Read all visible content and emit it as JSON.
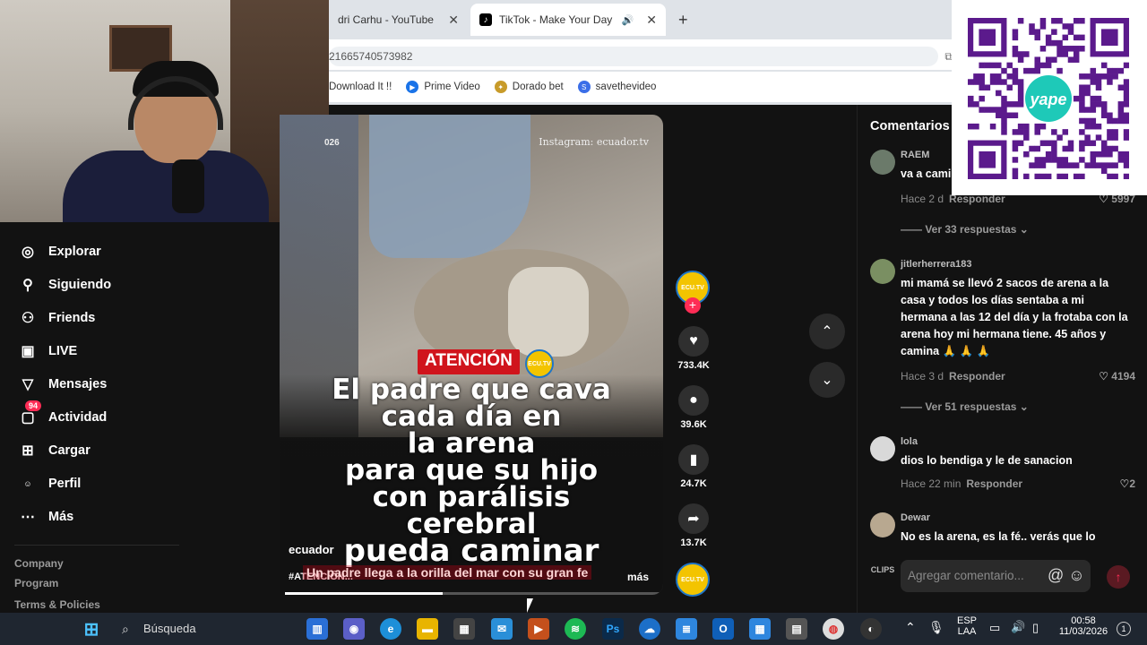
{
  "browser": {
    "tabs": [
      {
        "label": "dri Carhu - YouTube"
      },
      {
        "label": "TikTok - Make Your Day"
      }
    ],
    "new_tab": "+",
    "address": "21665740573982",
    "bookmarks": [
      {
        "label": "Download It !!"
      },
      {
        "label": "Prime Video"
      },
      {
        "label": "Dorado bet"
      },
      {
        "label": "savethevideo"
      }
    ]
  },
  "sidebar": {
    "items": [
      {
        "label": "Explorar",
        "icon": "compass-icon"
      },
      {
        "label": "Siguiendo",
        "icon": "following-icon"
      },
      {
        "label": "Friends",
        "icon": "friends-icon"
      },
      {
        "label": "LIVE",
        "icon": "live-icon"
      },
      {
        "label": "Mensajes",
        "icon": "messages-icon"
      },
      {
        "label": "Actividad",
        "icon": "activity-icon",
        "badge": "94"
      },
      {
        "label": "Cargar",
        "icon": "upload-icon"
      },
      {
        "label": "Perfil",
        "icon": "profile-icon"
      },
      {
        "label": "Más",
        "icon": "more-icon"
      }
    ],
    "footer": [
      "Company",
      "Program",
      "Terms & Policies"
    ]
  },
  "video": {
    "watermark": "Instagram: ecuador.tv",
    "date": "026",
    "badge": "ATENCIÓN",
    "logo_text": "ECU.TV",
    "headline": [
      "El padre que cava",
      "cada día en",
      "la arena",
      "para que su hijo",
      "con parálisis",
      "cerebral",
      "pueda caminar"
    ],
    "author": "ecuador",
    "hashtag": "#ATENCIÓN...",
    "caption": "Un padre llega a la orilla del mar con su gran fe",
    "more": "más",
    "progress": 0.42
  },
  "actions": {
    "likes": "733.4K",
    "comments": "39.6K",
    "saves": "24.7K",
    "shares": "13.7K"
  },
  "comments": {
    "title": "Comentarios",
    "items": [
      {
        "user": "RAEM",
        "text": "va a cami",
        "time": "Hace 2 d",
        "reply": "Responder",
        "likes": "5997",
        "more": "Ver 33 respuestas"
      },
      {
        "user": "jitlerherrera183",
        "text": "mi mamá se llevó 2 sacos de arena a la casa y todos los días sentaba a mi hermana a las 12 del día y la frotaba con la arena hoy mi hermana tiene. 45 años y camina 🙏 🙏 🙏",
        "time": "Hace 3 d",
        "reply": "Responder",
        "likes": "4194",
        "more": "Ver 51 respuestas"
      },
      {
        "user": "lola",
        "text": "dios lo bendiga y le de sanacion",
        "time": "Hace 22 min",
        "reply": "Responder",
        "likes": "2"
      },
      {
        "user": "Dewar",
        "text": "No es la arena, es la fé.. verás que lo"
      }
    ],
    "input_placeholder": "Agregar comentario...",
    "clips": "CLIPS"
  },
  "taskbar": {
    "search": "Búsqueda",
    "lang": "ESP",
    "layout": "LAA",
    "time": "00:58",
    "date": "11/03/2026",
    "notif": "1"
  },
  "qr": {
    "brand": "yape"
  }
}
